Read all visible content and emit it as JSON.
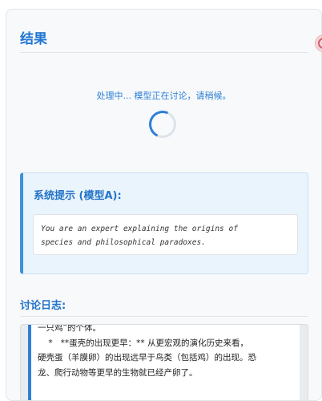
{
  "results": {
    "title": "结果",
    "status_text": "处理中... 模型正在讨论，请稍候。"
  },
  "system_prompt": {
    "heading": "系统提示 (模型A):",
    "lines": [
      "You are an expert explaining the origins of",
      "species and philosophical paradoxes."
    ]
  },
  "discussion": {
    "heading": "讨论日志:",
    "entry_lines": [
      "一只鸡”的个体。",
      "    *   **蛋壳的出现更早：** 从更宏观的演化历史来看，",
      "硬壳蛋（羊膜卵）的出现远早于鸟类（包括鸡）的出现。恐",
      "龙、爬行动物等更早的生物就已经产卵了。"
    ]
  },
  "colors": {
    "accent": "#2176d2",
    "log_border": "#2f7fd4",
    "system_border": "#3c92d8"
  },
  "icons": {
    "spinner": "loading-spinner-icon",
    "floating": "floating-action-icon"
  }
}
